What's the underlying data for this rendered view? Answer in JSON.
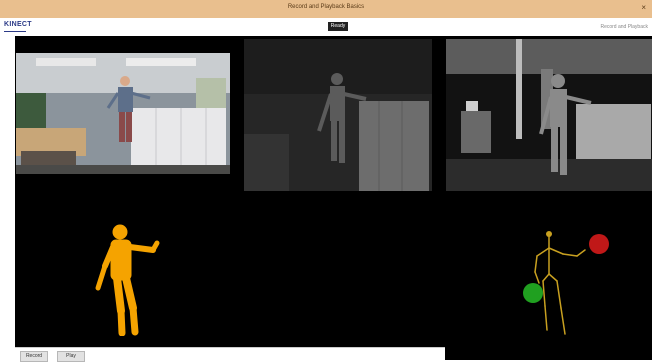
{
  "window": {
    "title": "Record and Playback Basics",
    "close_glyph": "×"
  },
  "header": {
    "logo": "KINECT",
    "selected_tab": "Ready",
    "app_label": "Record and Playback"
  },
  "buttons": {
    "record_label": "Record",
    "play_label": "Play"
  },
  "colors": {
    "title_bar": "#e9bf8e",
    "body_index": "#f5a300",
    "skeleton": "#c8a020",
    "hand_open": "#20a020",
    "hand_closed": "#c01818",
    "stage_bg": "#000000"
  }
}
